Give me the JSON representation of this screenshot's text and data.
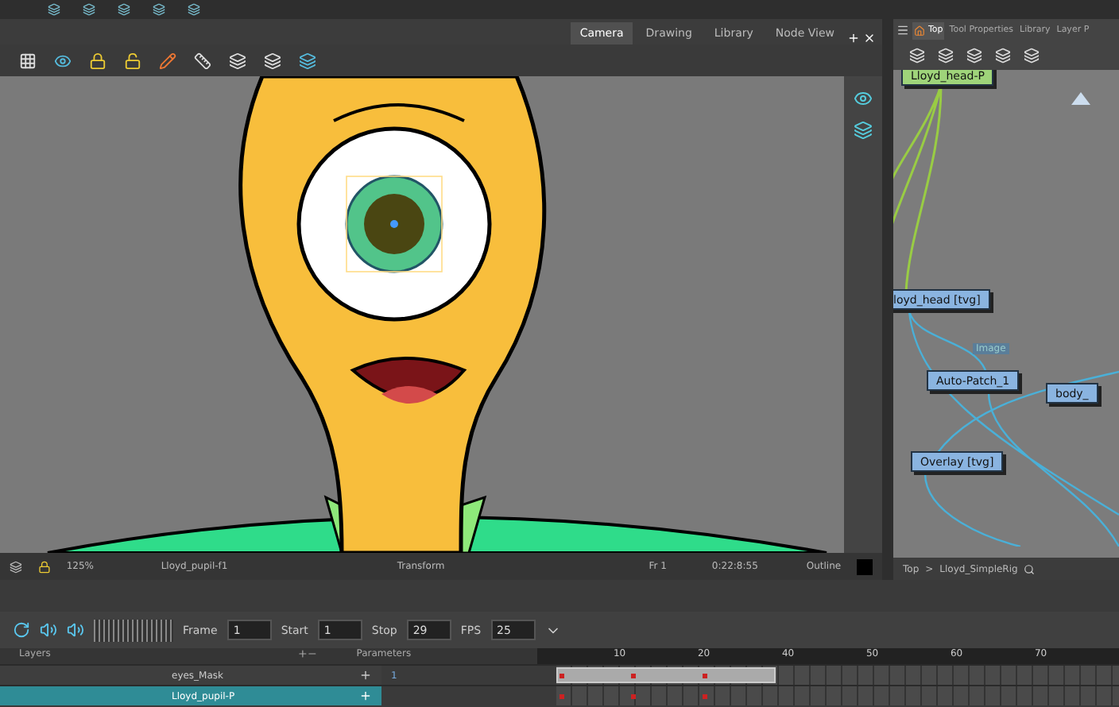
{
  "camera_tabs": [
    {
      "label": "Camera",
      "selected": true
    },
    {
      "label": "Drawing",
      "selected": false
    },
    {
      "label": "Library",
      "selected": false
    },
    {
      "label": "Node View",
      "selected": false
    }
  ],
  "camera_status": {
    "zoom": "125%",
    "drawing": "Lloyd_pupil-f1",
    "tool": "Transform",
    "frame": "Fr 1",
    "timecode": "0:22:8:55",
    "mode": "Outline"
  },
  "node_tabs": [
    {
      "label": "Top",
      "selected": true
    },
    {
      "label": "Tool Properties",
      "selected": false
    },
    {
      "label": "Library",
      "selected": false
    },
    {
      "label": "Layer P",
      "selected": false
    }
  ],
  "nodes": [
    {
      "label": "Lloyd_head-P",
      "kind": "peg"
    },
    {
      "label": "loyd_head [tvg]",
      "kind": "drawing"
    },
    {
      "label": "Auto-Patch_1",
      "kind": "patch"
    },
    {
      "label": "body_",
      "kind": "patch"
    },
    {
      "label": "Overlay [tvg]",
      "kind": "patch"
    }
  ],
  "port_label": "Image",
  "breadcrumb": [
    "Top",
    ">",
    "Lloyd_SimpleRig"
  ],
  "playback": [
    {
      "label": "Frame",
      "value": "1"
    },
    {
      "label": "Start",
      "value": "1"
    },
    {
      "label": "Stop",
      "value": "29"
    },
    {
      "label": "FPS",
      "value": "25"
    }
  ],
  "layers_header": {
    "layers": "Layers",
    "parameters": "Parameters"
  },
  "layers": [
    {
      "name": "eyes_Mask",
      "parameter": "1",
      "selected": false
    },
    {
      "name": "Lloyd_pupil-P",
      "selected": true
    }
  ],
  "ruler": [
    "10",
    "20",
    "40",
    "50",
    "60",
    "70"
  ]
}
